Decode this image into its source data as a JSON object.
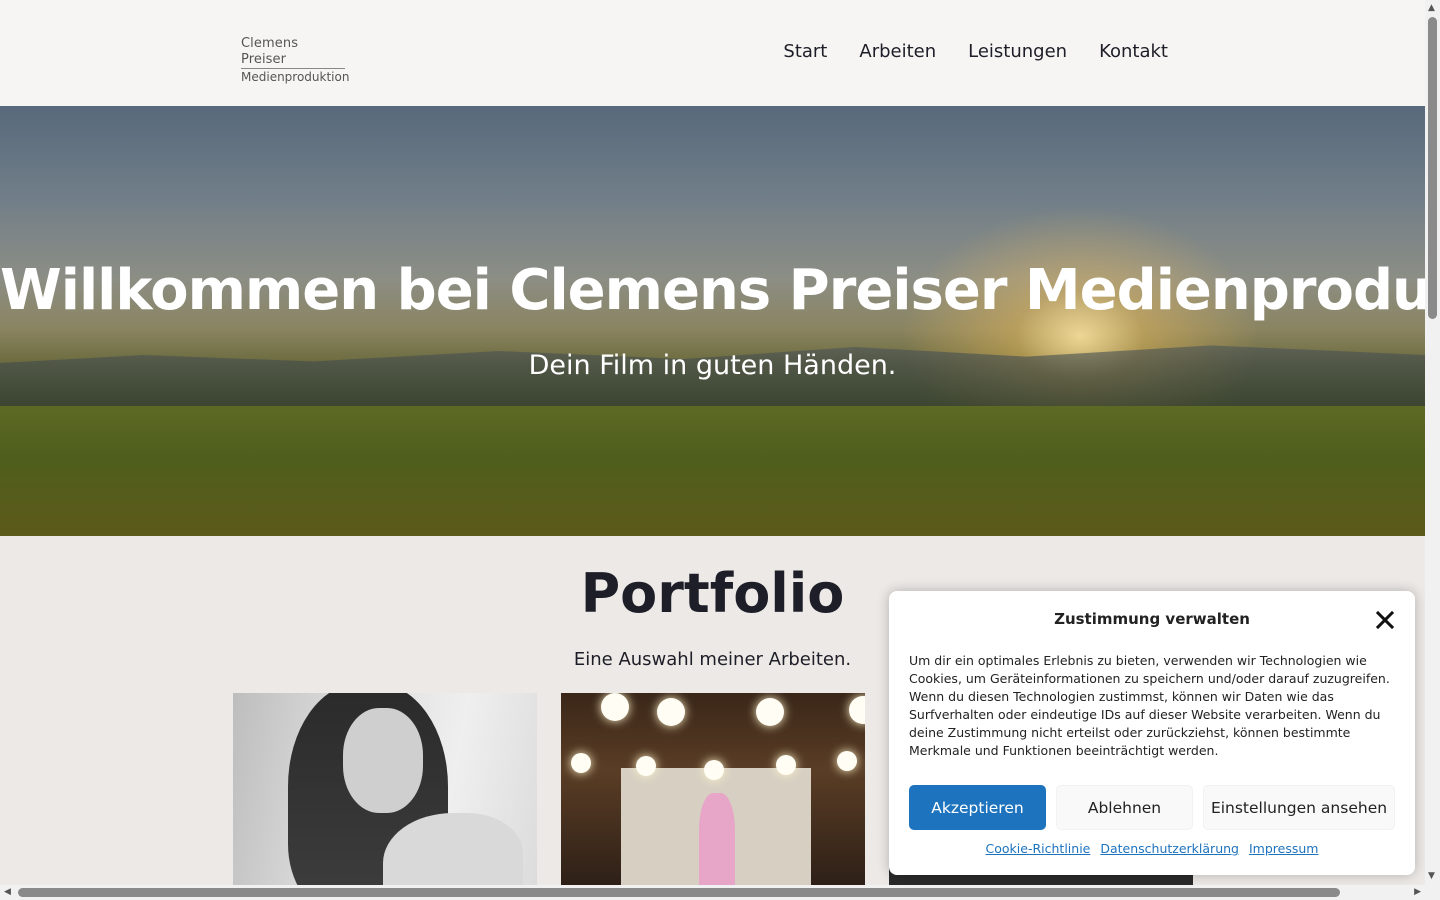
{
  "header": {
    "logo_line1": "Clemens Preiser",
    "logo_line2": "Medienproduktion",
    "nav": [
      "Start",
      "Arbeiten",
      "Leistungen",
      "Kontakt"
    ]
  },
  "hero": {
    "title": "Willkommen bei Clemens Preiser Medienproduktion",
    "subtitle": "Dein Film in guten Händen."
  },
  "portfolio": {
    "title": "Portfolio",
    "subtitle": "Eine Auswahl meiner Arbeiten."
  },
  "cookie_banner": {
    "title": "Zustimmung verwalten",
    "text": "Um dir ein optimales Erlebnis zu bieten, verwenden wir Technologien wie Cookies, um Geräteinformationen zu speichern und/oder darauf zuzugreifen. Wenn du diesen Technologien zustimmst, können wir Daten wie das Surfverhalten oder eindeutige IDs auf dieser Website verarbeiten. Wenn du deine Zustimmung nicht erteilst oder zurückziehst, können bestimmte Merkmale und Funktionen beeinträchtigt werden.",
    "accept_label": "Akzeptieren",
    "deny_label": "Ablehnen",
    "settings_label": "Einstellungen ansehen",
    "links": [
      "Cookie-Richtlinie",
      "Datenschutzerklärung",
      "Impressum"
    ]
  },
  "colors": {
    "accent": "#1e73be",
    "header_bg": "#f6f5f3",
    "page_bg": "#ece9e6",
    "text": "#1e1e28"
  }
}
